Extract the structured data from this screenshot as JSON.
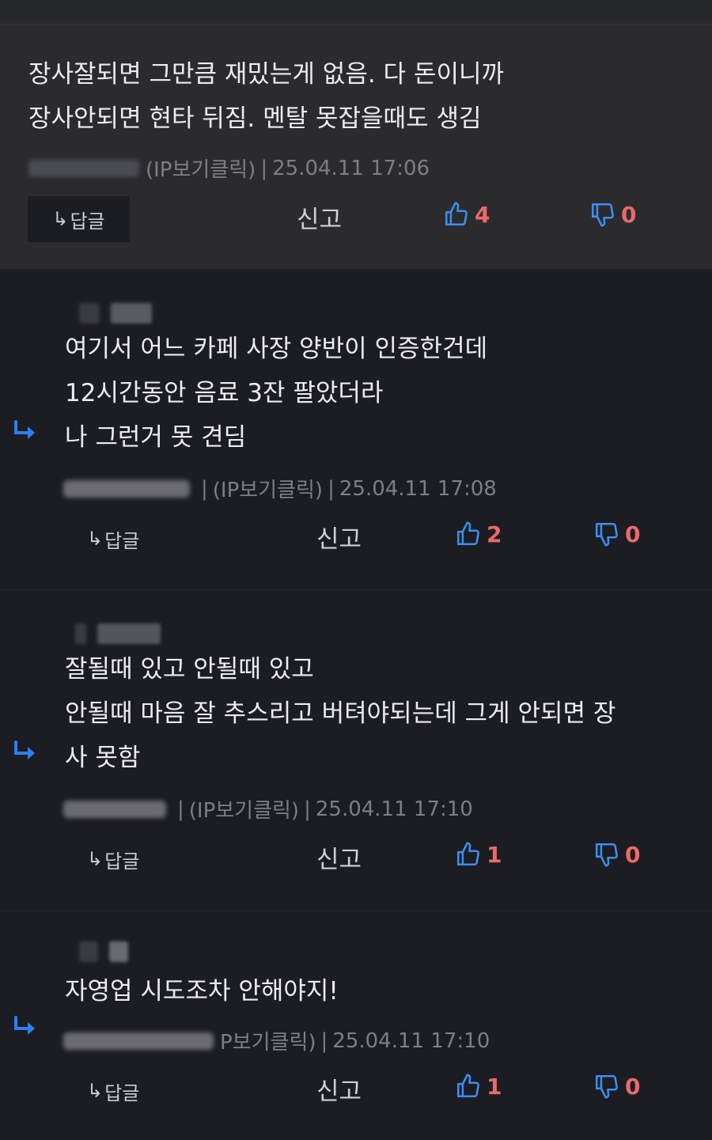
{
  "comments": [
    {
      "lines": [
        "장사잘되면 그만큼 재밌는게 없음. 다 돈이니까",
        "장사안되면 현타 뒤짐.  멘탈 못잡을때도 생김"
      ],
      "ip": "(IP보기클릭)",
      "date": "25.04.11 17:06",
      "reply": "답글",
      "report": "신고",
      "likes": "4",
      "dislikes": "0"
    },
    {
      "lines": [
        "여기서 어느 카페 사장 양반이 인증한건데",
        "12시간동안 음료 3잔 팔았더라",
        "나 그런거 못 견딤"
      ],
      "ip": "(IP보기클릭)",
      "date": "25.04.11 17:08",
      "reply": "답글",
      "report": "신고",
      "likes": "2",
      "dislikes": "0"
    },
    {
      "lines": [
        "잘될때 있고 안될때 있고",
        "안될때 마음 잘 추스리고 버텨야되는데 그게 안되면 장",
        "사 못함"
      ],
      "ip": "(IP보기클릭)",
      "date": "25.04.11 17:10",
      "reply": "답글",
      "report": "신고",
      "likes": "1",
      "dislikes": "0"
    },
    {
      "lines": [
        "자영업 시도조차 안해야지!"
      ],
      "ip": "P보기클릭)",
      "date": "25.04.11 17:10",
      "reply": "답글",
      "report": "신고",
      "likes": "1",
      "dislikes": "0"
    }
  ],
  "colors": {
    "accent": "#2f80ed",
    "count": "#ea6a6a",
    "background": "#1c1d22",
    "highlight": "#2b2b2e"
  },
  "icons": {
    "like": "thumbs-up-icon",
    "dislike": "thumbs-down-icon",
    "reply": "reply-arrow-icon"
  }
}
